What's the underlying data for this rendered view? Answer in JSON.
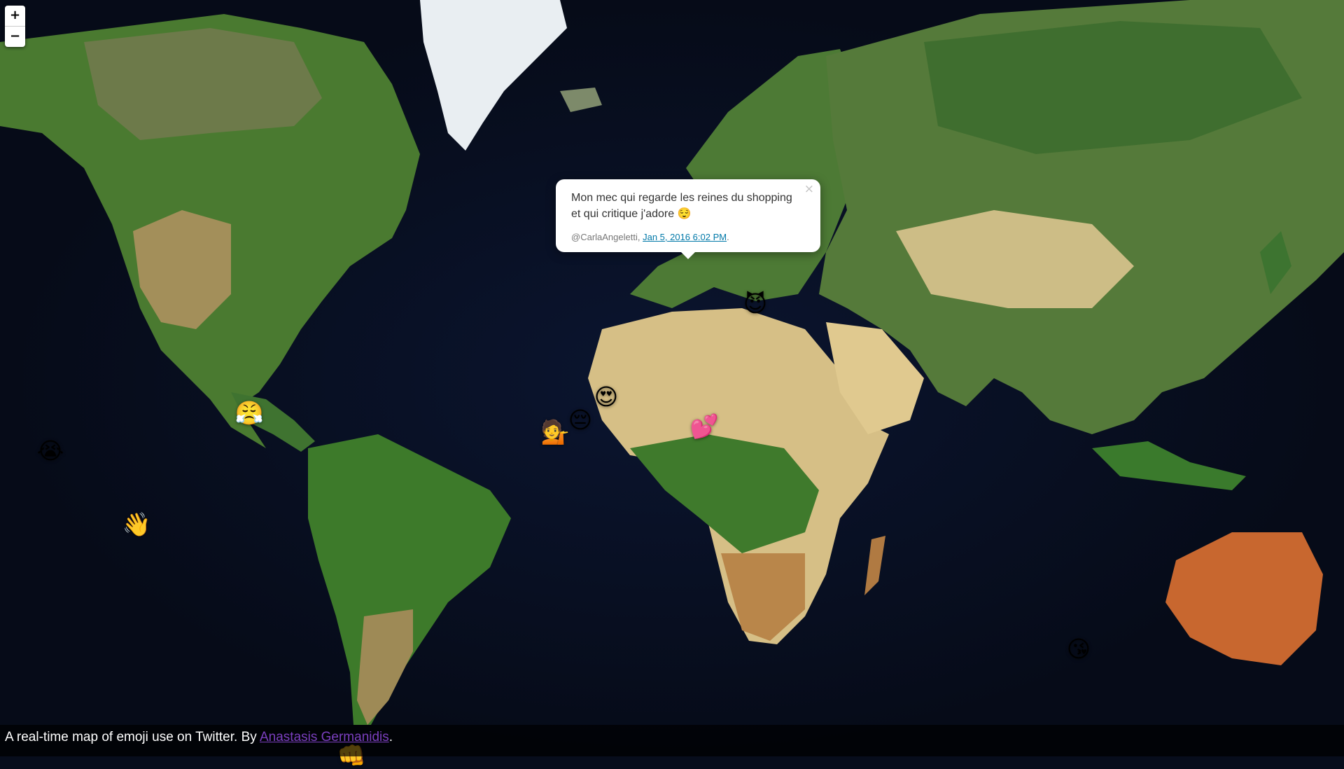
{
  "map": {
    "colors": {
      "ocean": "#070d1c",
      "forest": "#3a6b2a",
      "desert": "#d9c28a",
      "ice": "#eef2f5",
      "outback": "#c8672f"
    }
  },
  "zoom": {
    "in_label": "+",
    "out_label": "−"
  },
  "markers": [
    {
      "name": "Loudly Crying Face",
      "emoji": "😭",
      "lat": 34.0,
      "lng": -118.2
    },
    {
      "name": "Waving Hand",
      "emoji": "👋",
      "lat": 19.4,
      "lng": -99.1
    },
    {
      "name": "Face With Steam",
      "emoji": "😤",
      "lat": 40.7,
      "lng": -74.0
    },
    {
      "name": "Woman Tipping Hand",
      "emoji": "💁",
      "lat": 37.4,
      "lng": -6.0
    },
    {
      "name": "Pensive Face",
      "emoji": "😔",
      "lat": 39.5,
      "lng": -0.4
    },
    {
      "name": "Smiling Face With Heart-Eyes",
      "emoji": "😍",
      "lat": 43.3,
      "lng": 5.4
    },
    {
      "name": "Two Hearts",
      "emoji": "💕",
      "lat": 38.4,
      "lng": 27.1
    },
    {
      "name": "Smiling Face With Horns",
      "emoji": "😈",
      "lat": 56.5,
      "lng": 38.5
    },
    {
      "name": "Face Blowing a Kiss",
      "emoji": "😘",
      "lat": -7.8,
      "lng": 110.4
    },
    {
      "name": "Oncoming Fist",
      "emoji": "👊",
      "lat": -30.0,
      "lng": -51.2
    }
  ],
  "popup": {
    "text": "Mon mec qui regarde les reines du shopping et qui critique j'adore 😌",
    "author": "@CarlaAngeletti,",
    "timestamp": "Jan 5, 2016 6:02 PM",
    "trailing": ".",
    "close": "×"
  },
  "footer": {
    "text": "A real-time map of emoji use on Twitter. By",
    "author_link": "Anastasis Germanidis",
    "end": "."
  }
}
